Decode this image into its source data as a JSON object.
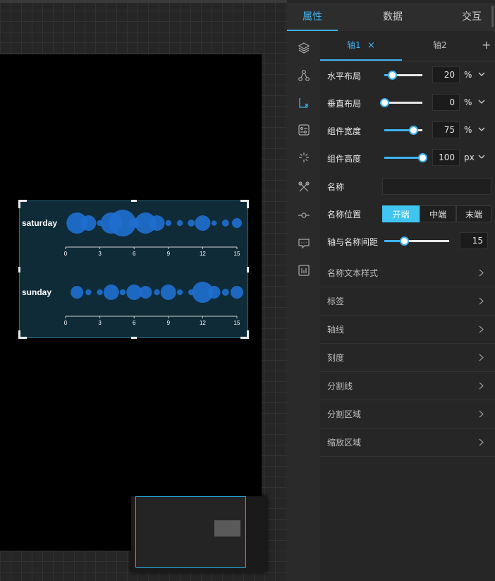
{
  "panel": {
    "tabs": [
      "属性",
      "数据",
      "交互"
    ],
    "active_tab": "属性",
    "sidebar_icons": [
      "layers-icon",
      "nodes-icon",
      "axis-icon",
      "settings-card-icon",
      "sparkle-icon",
      "tools-icon",
      "node-point-icon",
      "comment-icon",
      "bar-box-icon"
    ]
  },
  "axis_tabs": {
    "tab1": "轴1",
    "close": "×",
    "tab2": "轴2",
    "add": "+"
  },
  "layout": {
    "h": {
      "label": "水平布局",
      "value": "20",
      "unit": "%",
      "level": 0.2
    },
    "v": {
      "label": "垂直布局",
      "value": "0",
      "unit": "%",
      "level": 0
    },
    "w": {
      "label": "组件宽度",
      "value": "75",
      "unit": "%",
      "level": 0.75
    },
    "hgt": {
      "label": "组件高度",
      "value": "100",
      "unit": "px",
      "level": 1
    }
  },
  "name": {
    "label": "名称",
    "value": ""
  },
  "name_pos": {
    "label": "名称位置",
    "options": [
      "开端",
      "中端",
      "末端"
    ],
    "selected": "开端"
  },
  "gap": {
    "label": "轴与名称间距",
    "value": "15",
    "level": 0.3
  },
  "sections": [
    "名称文本样式",
    "标签",
    "轴线",
    "刻度",
    "分割线",
    "分割区域",
    "缩放区域"
  ],
  "colors": {
    "accent": "#3fb3f0",
    "bubble": "#1f6fd0",
    "widget_bg": "#0f2b38"
  },
  "chart_data": {
    "type": "scatter",
    "rows": [
      {
        "name": "saturday",
        "points": [
          [
            1,
            3
          ],
          [
            2,
            2
          ],
          [
            3,
            0.3
          ],
          [
            4,
            3
          ],
          [
            5,
            4
          ],
          [
            6,
            1
          ],
          [
            7,
            3
          ],
          [
            8,
            2
          ],
          [
            9,
            0.3
          ],
          [
            10,
            0.3
          ],
          [
            11,
            0.5
          ],
          [
            12,
            2
          ],
          [
            13,
            0.2
          ],
          [
            14,
            0.5
          ],
          [
            15,
            1
          ]
        ]
      },
      {
        "name": "sunday",
        "points": [
          [
            1,
            1.5
          ],
          [
            2,
            0.3
          ],
          [
            3,
            0.3
          ],
          [
            4,
            2
          ],
          [
            5,
            0.3
          ],
          [
            6,
            2
          ],
          [
            7,
            1.5
          ],
          [
            8,
            0.3
          ],
          [
            9,
            2
          ],
          [
            10,
            0.3
          ],
          [
            11,
            0.3
          ],
          [
            12,
            3
          ],
          [
            13,
            1.5
          ],
          [
            14,
            0.5
          ],
          [
            15,
            1.5
          ]
        ]
      }
    ],
    "x_ticks": [
      "0",
      "3",
      "6",
      "9",
      "12",
      "15"
    ],
    "xlim": [
      0,
      15
    ]
  }
}
